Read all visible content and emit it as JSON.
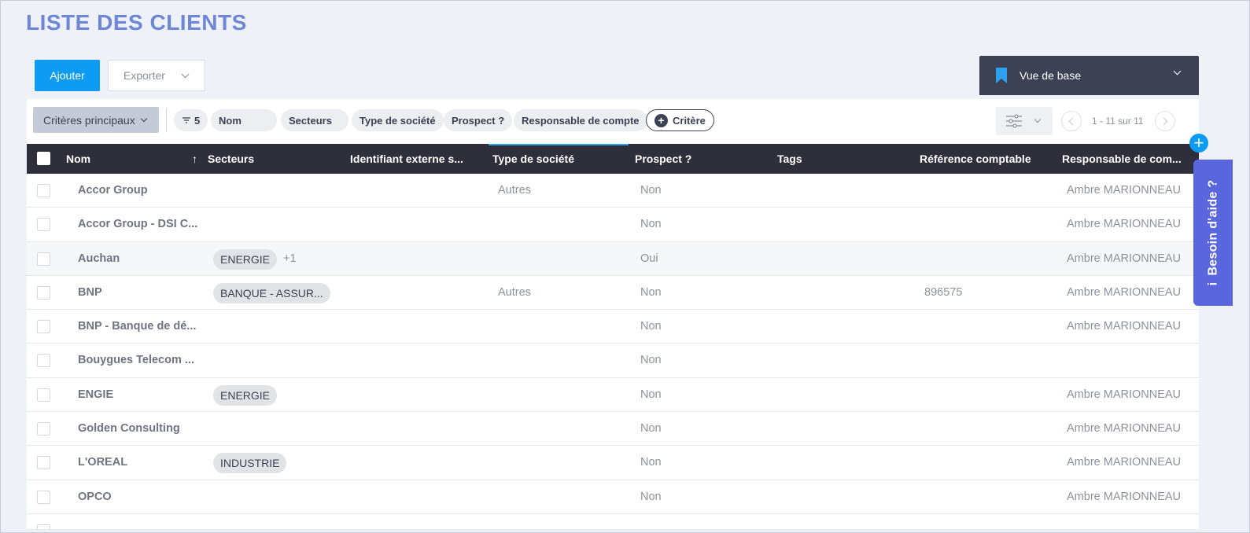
{
  "page": {
    "title": "LISTE DES CLIENTS"
  },
  "toolbar": {
    "add_label": "Ajouter",
    "export_label": "Exporter"
  },
  "view": {
    "label": "Vue de base"
  },
  "filters": {
    "main_criteria": "Critères principaux",
    "count": "5",
    "pills": [
      "Nom",
      "Secteurs",
      "Type de société",
      "Prospect ?",
      "Responsable de compte"
    ],
    "add_criteria": "Critère"
  },
  "pager": {
    "text": "1 - 11 sur 11"
  },
  "table": {
    "sort_arrow": "↑",
    "columns": [
      "Nom",
      "Secteurs",
      "Identifiant externe s...",
      "Type de société",
      "Prospect ?",
      "Tags",
      "Référence comptable",
      "Responsable de com..."
    ],
    "rows": [
      {
        "nom": "Accor Group",
        "secteur": "",
        "secteur_more": "",
        "type": "Autres",
        "prospect": "Non",
        "ref": "",
        "resp": "Ambre MARIONNEAU"
      },
      {
        "nom": "Accor Group - DSI C...",
        "secteur": "",
        "secteur_more": "",
        "type": "",
        "prospect": "Non",
        "ref": "",
        "resp": "Ambre MARIONNEAU"
      },
      {
        "nom": "Auchan",
        "secteur": "ENERGIE",
        "secteur_more": "+1",
        "type": "",
        "prospect": "Oui",
        "ref": "",
        "resp": "Ambre MARIONNEAU"
      },
      {
        "nom": "BNP",
        "secteur": "BANQUE - ASSUR...",
        "secteur_more": "",
        "type": "Autres",
        "prospect": "Non",
        "ref": "896575",
        "resp": "Ambre MARIONNEAU"
      },
      {
        "nom": "BNP - Banque de dé...",
        "secteur": "",
        "secteur_more": "",
        "type": "",
        "prospect": "Non",
        "ref": "",
        "resp": "Ambre MARIONNEAU"
      },
      {
        "nom": "Bouygues Telecom ...",
        "secteur": "",
        "secteur_more": "",
        "type": "",
        "prospect": "Non",
        "ref": "",
        "resp": ""
      },
      {
        "nom": "ENGIE",
        "secteur": "ENERGIE",
        "secteur_more": "",
        "type": "",
        "prospect": "Non",
        "ref": "",
        "resp": "Ambre MARIONNEAU"
      },
      {
        "nom": "Golden Consulting",
        "secteur": "",
        "secteur_more": "",
        "type": "",
        "prospect": "Non",
        "ref": "",
        "resp": "Ambre MARIONNEAU"
      },
      {
        "nom": "L'OREAL",
        "secteur": "INDUSTRIE",
        "secteur_more": "",
        "type": "",
        "prospect": "Non",
        "ref": "",
        "resp": "Ambre MARIONNEAU"
      },
      {
        "nom": "OPCO",
        "secteur": "",
        "secteur_more": "",
        "type": "",
        "prospect": "Non",
        "ref": "",
        "resp": "Ambre MARIONNEAU"
      }
    ]
  },
  "help": {
    "label": "Besoin d'aide ?",
    "icon": "info-icon",
    "icon_glyph": "i"
  },
  "colors": {
    "accent": "#0e9cf2",
    "title": "#6e86d6",
    "header_bg": "#2f2f3c",
    "help_bg": "#5a66dd"
  }
}
